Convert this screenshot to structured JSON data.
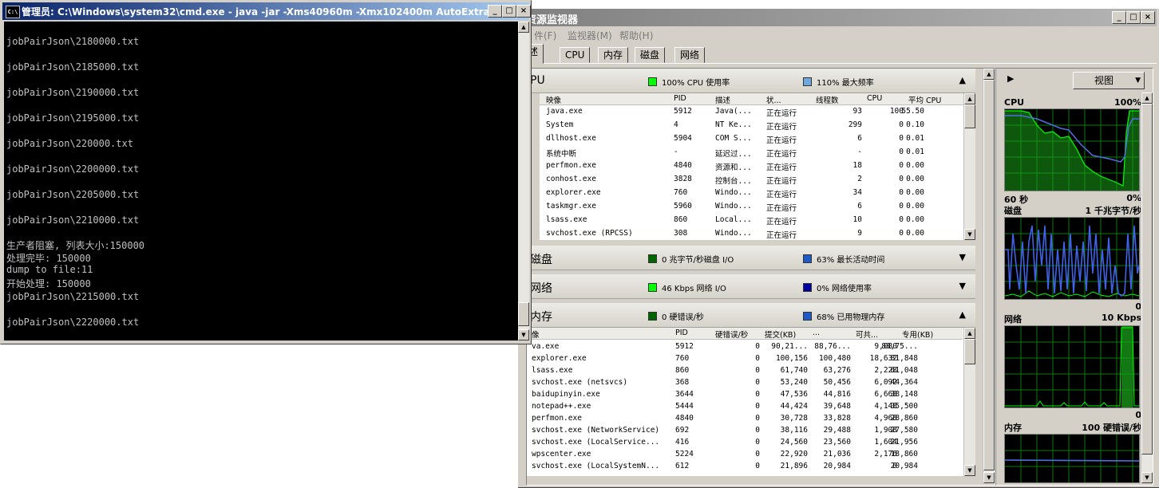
{
  "cmd": {
    "title": "管理员: C:\\Windows\\system32\\cmd.exe - java  -jar -Xms40960m -Xmx102400m AutoExtra...",
    "icon": "C:\\",
    "lines": [
      "jobPairJson\\2180000.txt",
      "jobPairJson\\2185000.txt",
      "jobPairJson\\2190000.txt",
      "jobPairJson\\2195000.txt",
      "jobPairJson\\220000.txt",
      "jobPairJson\\2200000.txt",
      "jobPairJson\\2205000.txt",
      "jobPairJson\\2210000.txt",
      "生产者阻塞, 列表大小:150000",
      "处理完毕: 150000",
      "dump to file:11",
      "开始处理: 150000",
      "jobPairJson\\2215000.txt",
      "jobPairJson\\2220000.txt"
    ]
  },
  "rm": {
    "title": "资源监视器",
    "menu": [
      "件(F)",
      "监视器(M)",
      "帮助(H)"
    ],
    "tabs": [
      "述",
      "CPU",
      "内存",
      "磁盘",
      "网络"
    ],
    "cpu": {
      "name": "PU",
      "ind1": "100% CPU 使用率",
      "ind2": "110% 最大频率",
      "ind1_color": "#00ff00",
      "ind2_color": "#6fa8dc",
      "columns": [
        "映像",
        "PID",
        "描述",
        "状...",
        "线程数",
        "CPU",
        "平均 CPU"
      ],
      "rows": [
        [
          "java.exe",
          "5912",
          "Java(...",
          "正在运行",
          "93",
          "100",
          "55.50"
        ],
        [
          "System",
          "4",
          "NT Ke...",
          "正在运行",
          "299",
          "0",
          "0.10"
        ],
        [
          "dllhost.exe",
          "5904",
          "COM S...",
          "正在运行",
          "6",
          "0",
          "0.01"
        ],
        [
          "系统中断",
          "-",
          "延迟过...",
          "正在运行",
          "-",
          "0",
          "0.01"
        ],
        [
          "perfmon.exe",
          "4840",
          "资源和...",
          "正在运行",
          "18",
          "0",
          "0.00"
        ],
        [
          "conhost.exe",
          "3828",
          "控制台...",
          "正在运行",
          "2",
          "0",
          "0.00"
        ],
        [
          "explorer.exe",
          "760",
          "Windo...",
          "正在运行",
          "34",
          "0",
          "0.00"
        ],
        [
          "taskmgr.exe",
          "5960",
          "Windo...",
          "正在运行",
          "6",
          "0",
          "0.00"
        ],
        [
          "lsass.exe",
          "860",
          "Local...",
          "正在运行",
          "10",
          "0",
          "0.00"
        ],
        [
          "svchost.exe (RPCSS)",
          "308",
          "Windo...",
          "正在运行",
          "9",
          "0",
          "0.00"
        ]
      ]
    },
    "disk": {
      "name": "磁盘",
      "ind1": "0 兆字节/秒磁盘 I/O",
      "ind2": "63% 最长活动时间",
      "ind1_color": "#006400",
      "ind2_color": "#1e5bc6"
    },
    "net": {
      "name": "网络",
      "ind1": "46 Kbps 网络 I/O",
      "ind2": "0% 网络使用率",
      "ind1_color": "#00ff00",
      "ind2_color": "#0000a0"
    },
    "mem": {
      "name": "内存",
      "ind1": "0 硬错误/秒",
      "ind2": "68% 已用物理内存",
      "ind1_color": "#006400",
      "ind2_color": "#1e5bc6",
      "columns": [
        "像",
        "PID",
        "硬错误/秒",
        "提交(KB)",
        "...",
        "可共...",
        "专用(KB)"
      ],
      "rows": [
        [
          "va.exe",
          "5912",
          "0",
          "90,21...",
          "88,76...",
          "9,080",
          "88,75..."
        ],
        [
          "explorer.exe",
          "760",
          "0",
          "100,156",
          "100,480",
          "18,632",
          "81,848"
        ],
        [
          "lsass.exe",
          "860",
          "0",
          "61,740",
          "63,276",
          "2,228",
          "61,048"
        ],
        [
          "svchost.exe (netsvcs)",
          "368",
          "0",
          "53,240",
          "50,456",
          "6,092",
          "44,364"
        ],
        [
          "baidupinyin.exe",
          "3644",
          "0",
          "47,536",
          "44,816",
          "6,668",
          "38,148"
        ],
        [
          "notepad++.exe",
          "5444",
          "0",
          "44,424",
          "39,648",
          "4,148",
          "35,500"
        ],
        [
          "perfmon.exe",
          "4840",
          "0",
          "30,728",
          "33,828",
          "4,968",
          "28,860"
        ],
        [
          "svchost.exe (NetworkService)",
          "692",
          "0",
          "38,116",
          "29,488",
          "1,908",
          "27,580"
        ],
        [
          "svchost.exe (LocalService...",
          "416",
          "0",
          "24,560",
          "23,560",
          "1,604",
          "21,956"
        ],
        [
          "wpscenter.exe",
          "5224",
          "0",
          "22,920",
          "21,036",
          "2,176",
          "18,860"
        ],
        [
          "svchost.exe (LocalSystemN...",
          "612",
          "0",
          "21,896",
          "20,984",
          "0",
          "20,984"
        ]
      ]
    },
    "right": {
      "view_label": "视图",
      "cpu_label": "CPU",
      "cpu_max": "100%",
      "cpu_time": "60 秒",
      "cpu_min": "0%",
      "disk_label": "磁盘",
      "disk_max": "1 千兆字节/秒",
      "disk_min": "0",
      "net_label": "网络",
      "net_max": "10 Kbps",
      "net_min": "0",
      "mem_label": "内存",
      "mem_max": "100 硬错误/秒"
    }
  }
}
